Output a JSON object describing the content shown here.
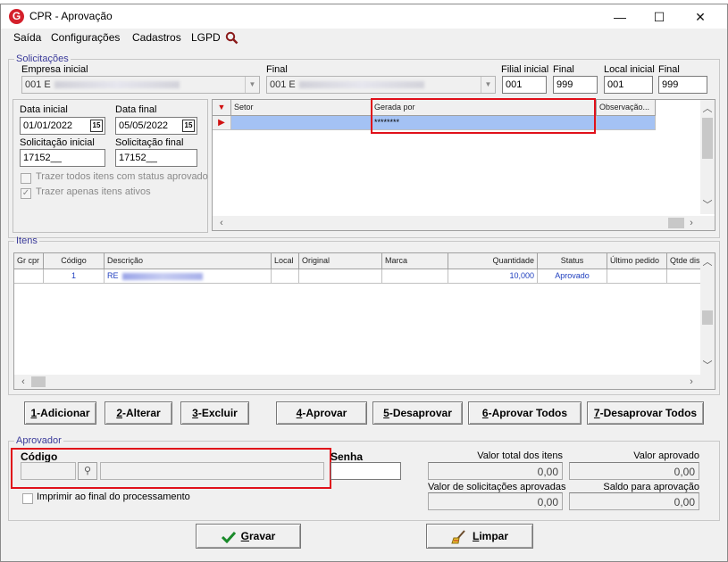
{
  "window": {
    "title": "CPR - Aprovação",
    "controls": [
      "—",
      "☐",
      "✕"
    ]
  },
  "menu": {
    "items": [
      "Saída",
      "Configurações",
      "Cadastros",
      "LGPD"
    ]
  },
  "solicitacoes": {
    "legend": "Solicitações",
    "empresa_inicial_label": "Empresa inicial",
    "empresa_inicial_value": "001 E",
    "empresa_final_label": "Final",
    "empresa_final_value": "001 E",
    "filial_inicial_label": "Filial inicial",
    "filial_inicial_value": "001",
    "filial_final_label": "Final",
    "filial_final_value": "999",
    "local_inicial_label": "Local inicial",
    "local_inicial_value": "001",
    "local_final_label": "Final",
    "local_final_value": "999",
    "data_inicial_label": "Data inicial",
    "data_inicial_value": "01/01/2022",
    "data_final_label": "Data final",
    "data_final_value": "05/05/2022",
    "cal_icon_text": "15",
    "solicitacao_inicial_label": "Solicitação inicial",
    "solicitacao_inicial_value": "17152__",
    "solicitacao_final_label": "Solicitação final",
    "solicitacao_final_value": "17152__",
    "chk_aprovado_label": "Trazer todos itens com status aprovado",
    "chk_aprovado": false,
    "chk_ativos_label": "Trazer apenas itens ativos",
    "chk_ativos": true
  },
  "sol_grid": {
    "columns": [
      "Setor",
      "Gerada por",
      "Observação..."
    ],
    "rows": [
      {
        "setor": "",
        "gerada_por": "********",
        "observacao": ""
      }
    ]
  },
  "itens": {
    "legend": "Itens",
    "columns": [
      "Gr cpr",
      "Código",
      "Descrição",
      "Local",
      "Original",
      "Marca",
      "Quantidade",
      "Status",
      "Último pedido",
      "Qtde dis"
    ],
    "rows": [
      {
        "gr_cpr": "",
        "codigo": "1",
        "descricao": "RE",
        "local": "",
        "original": "",
        "marca": "",
        "quantidade": "10,000",
        "status": "Aprovado",
        "ultimo_pedido": "",
        "qtde": ""
      }
    ]
  },
  "actions": [
    {
      "key": "1",
      "label": "-Adicionar"
    },
    {
      "key": "2",
      "label": "-Alterar"
    },
    {
      "key": "3",
      "label": "-Excluir"
    },
    {
      "key": "4",
      "label": "-Aprovar"
    },
    {
      "key": "5",
      "label": "-Desaprovar"
    },
    {
      "key": "6",
      "label": "-Aprovar Todos"
    },
    {
      "key": "7",
      "label": "-Desaprovar Todos"
    }
  ],
  "aprovador": {
    "legend": "Aprovador",
    "codigo_label": "Código",
    "codigo_value": "",
    "nome_value": "",
    "senha_label": "Senha",
    "imprimir_label": "Imprimir ao final do processamento",
    "valor_total_label": "Valor total dos itens",
    "valor_total": "0,00",
    "valor_aprovado_label": "Valor aprovado",
    "valor_aprovado": "0,00",
    "valor_solicitacoes_label": "Valor de solicitações aprovadas",
    "valor_solicitacoes": "0,00",
    "saldo_label": "Saldo para aprovação",
    "saldo": "0,00"
  },
  "footer": {
    "gravar_key": "G",
    "gravar_rest": "ravar",
    "limpar_key": "L",
    "limpar_rest": "impar"
  },
  "colors": {
    "highlight_red": "#e0101a",
    "selected_row": "#a4c2f4",
    "accent_blue": "#1f3fbf"
  }
}
